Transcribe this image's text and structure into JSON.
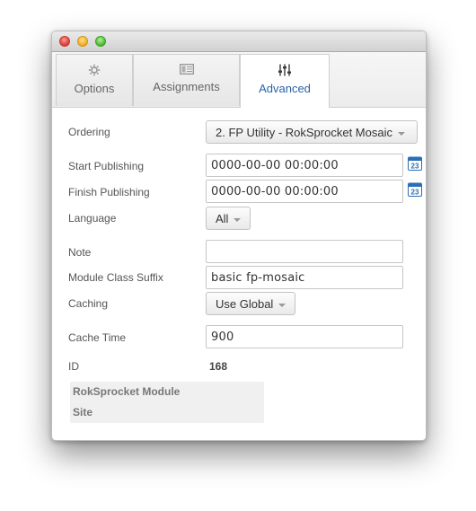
{
  "tabs": {
    "options": {
      "label": "Options",
      "icon": "gear-icon"
    },
    "assignments": {
      "label": "Assignments",
      "icon": "assignments-icon"
    },
    "advanced": {
      "label": "Advanced",
      "icon": "sliders-icon",
      "active": true
    }
  },
  "form": {
    "ordering": {
      "label": "Ordering",
      "value": "2. FP Utility - RokSprocket Mosaic"
    },
    "start_publishing": {
      "label": "Start Publishing",
      "value": "0000-00-00 00:00:00"
    },
    "finish_publishing": {
      "label": "Finish Publishing",
      "value": "0000-00-00 00:00:00"
    },
    "language": {
      "label": "Language",
      "value": "All"
    },
    "note": {
      "label": "Note",
      "value": ""
    },
    "module_class_suffix": {
      "label": "Module Class Suffix",
      "value": "basic fp-mosaic"
    },
    "caching": {
      "label": "Caching",
      "value": "Use Global"
    },
    "cache_time": {
      "label": "Cache Time",
      "value": "900"
    },
    "id": {
      "label": "ID",
      "value": "168"
    }
  },
  "calendar_icon_text": "23",
  "info": {
    "line1": "RokSprocket Module",
    "line2": "Site"
  },
  "colors": {
    "active_tab_text": "#2a62a8",
    "calendar_blue": "#2b6fb6"
  }
}
